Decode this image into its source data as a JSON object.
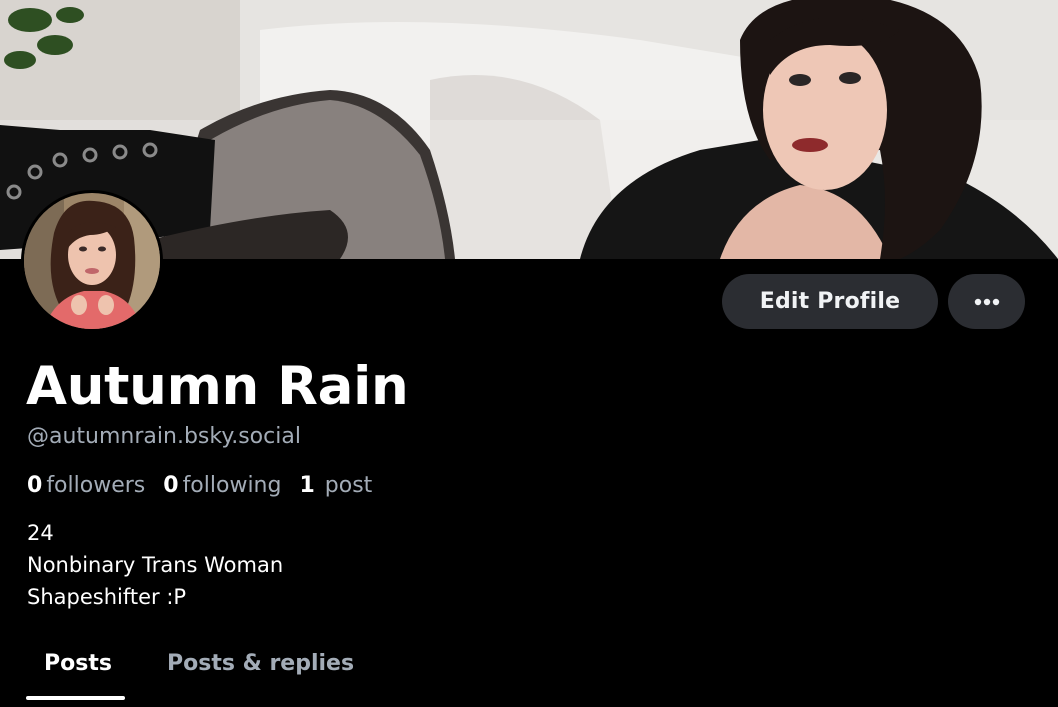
{
  "profile": {
    "display_name": "Autumn Rain",
    "handle": "@autumnrain.bsky.social",
    "followers_count": "0",
    "followers_label": "followers",
    "following_count": "0",
    "following_label": "following",
    "posts_count": "1",
    "posts_label": "post",
    "bio_lines": [
      "24",
      "Nonbinary Trans Woman",
      "Shapeshifter :P"
    ]
  },
  "actions": {
    "edit_profile_label": "Edit Profile",
    "more_icon": "ellipsis-icon"
  },
  "tabs": [
    {
      "label": "Posts",
      "active": true
    },
    {
      "label": "Posts & replies",
      "active": false
    }
  ],
  "colors": {
    "background": "#000000",
    "button_bg": "#2b2d32",
    "muted_text": "#a3acb7",
    "primary_text": "#ffffff"
  }
}
